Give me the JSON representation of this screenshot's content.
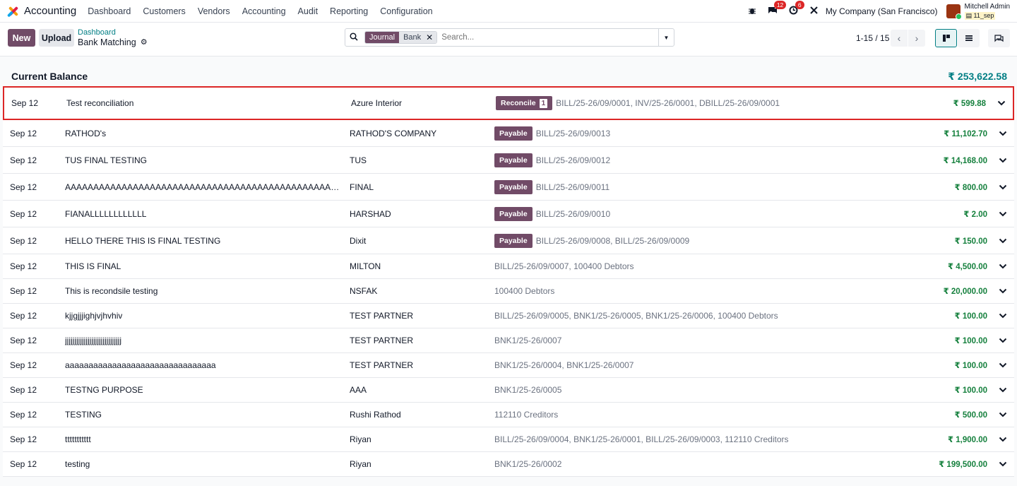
{
  "navbar": {
    "app_name": "Accounting",
    "menu": [
      "Dashboard",
      "Customers",
      "Vendors",
      "Accounting",
      "Audit",
      "Reporting",
      "Configuration"
    ],
    "messages_count": "12",
    "activity_count": "6",
    "company": "My Company (San Francisco)",
    "user_name": "Mitchell Admin",
    "db_name": "11_sep"
  },
  "control": {
    "new_label": "New",
    "upload_label": "Upload",
    "breadcrumb_parent": "Dashboard",
    "breadcrumb_current": "Bank Matching",
    "facet_label": "Journal",
    "facet_value": "Bank",
    "search_placeholder": "Search...",
    "pager": "1-15 / 15"
  },
  "balance": {
    "label": "Current Balance",
    "value": "₹ 253,622.58"
  },
  "lines": [
    {
      "date": "Sep 12",
      "label": "Test reconciliation",
      "partner": "Azure Interior",
      "tag": "Reconcile",
      "tag_count": "1",
      "ref": "BILL/25-26/09/0001, INV/25-26/0001, DBILL/25-26/09/0001",
      "amount": "₹ 599.88"
    },
    {
      "date": "Sep 12",
      "label": "RATHOD's",
      "partner": "RATHOD'S COMPANY",
      "tag": "Payable",
      "ref": "BILL/25-26/09/0013",
      "amount": "₹ 11,102.70"
    },
    {
      "date": "Sep 12",
      "label": "TUS FINAL TESTING",
      "partner": "TUS",
      "tag": "Payable",
      "ref": "BILL/25-26/09/0012",
      "amount": "₹ 14,168.00"
    },
    {
      "date": "Sep 12",
      "label": "AAAAAAAAAAAAAAAAAAAAAAAAAAAAAAAAAAAAAAAAAAAAAAAAAAAAAAAAAAAAAAAAAAA",
      "partner": "FINAL",
      "tag": "Payable",
      "ref": "BILL/25-26/09/0011",
      "amount": "₹ 800.00"
    },
    {
      "date": "Sep 12",
      "label": "FIANALLLLLLLLLLLL",
      "partner": "HARSHAD",
      "tag": "Payable",
      "ref": "BILL/25-26/09/0010",
      "amount": "₹ 2.00"
    },
    {
      "date": "Sep 12",
      "label": "HELLO THERE THIS IS FINAL TESTING",
      "partner": "Dixit",
      "tag": "Payable",
      "ref": "BILL/25-26/09/0008, BILL/25-26/09/0009",
      "amount": "₹ 150.00"
    },
    {
      "date": "Sep 12",
      "label": "THIS IS FINAL",
      "partner": "MILTON",
      "ref": "BILL/25-26/09/0007, 100400 Debtors",
      "amount": "₹ 4,500.00"
    },
    {
      "date": "Sep 12",
      "label": "This is recondsile testing",
      "partner": "NSFAK",
      "ref": "100400 Debtors",
      "amount": "₹ 20,000.00"
    },
    {
      "date": "Sep 12",
      "label": "kjjgjjjighjvjhvhiv",
      "partner": "TEST PARTNER",
      "ref": "BILL/25-26/09/0005, BNK1/25-26/0005, BNK1/25-26/0006, 100400 Debtors",
      "amount": "₹ 100.00"
    },
    {
      "date": "Sep 12",
      "label": "jjjjjjjjjjjjjjjjjjjjjjjjjjjjjj",
      "partner": "TEST PARTNER",
      "ref": "BNK1/25-26/0007",
      "amount": "₹ 100.00"
    },
    {
      "date": "Sep 12",
      "label": "aaaaaaaaaaaaaaaaaaaaaaaaaaaaaaaa",
      "partner": "TEST PARTNER",
      "ref": "BNK1/25-26/0004, BNK1/25-26/0007",
      "amount": "₹ 100.00"
    },
    {
      "date": "Sep 12",
      "label": "TESTNG PURPOSE",
      "partner": "AAA",
      "ref": "BNK1/25-26/0005",
      "amount": "₹ 100.00"
    },
    {
      "date": "Sep 12",
      "label": "TESTING",
      "partner": "Rushi Rathod",
      "ref": "112110 Creditors",
      "amount": "₹ 500.00"
    },
    {
      "date": "Sep 12",
      "label": "ttttttttttt",
      "partner": "Riyan",
      "ref": "BILL/25-26/09/0004, BNK1/25-26/0001, BILL/25-26/09/0003, 112110 Creditors",
      "amount": "₹ 1,900.00"
    },
    {
      "date": "Sep 12",
      "label": "testing",
      "partner": "Riyan",
      "ref": "BNK1/25-26/0002",
      "amount": "₹ 199,500.00"
    }
  ],
  "icons": {
    "search": "search-icon",
    "debug": "bug-icon",
    "messages": "chat-icon",
    "activity": "clock-icon",
    "settings": "tools-icon",
    "expand": "chevron-down-icon"
  }
}
